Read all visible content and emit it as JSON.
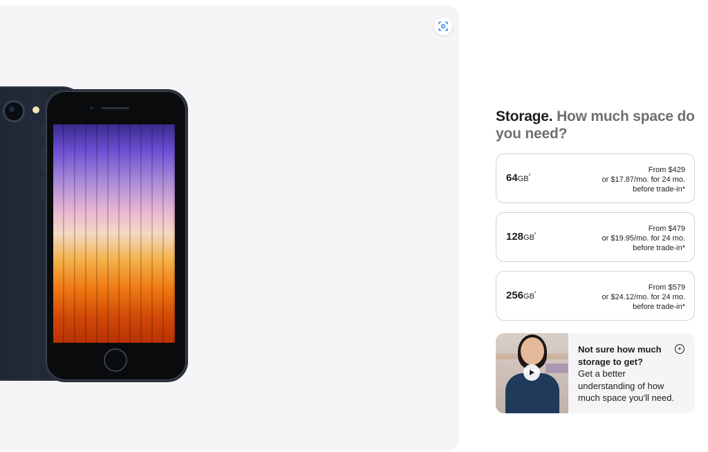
{
  "gallery": {
    "zoom_icon": "scan-zoom-icon",
    "background": "#f5f5f7"
  },
  "storage": {
    "heading_strong": "Storage.",
    "heading_muted": "How much space do you need?",
    "options": [
      {
        "size": "64",
        "unit": "GB",
        "footnote": "²",
        "from": "From $429",
        "monthly": "or $17.87/mo. for 24 mo.",
        "note": "before trade‑in*"
      },
      {
        "size": "128",
        "unit": "GB",
        "footnote": "²",
        "from": "From $479",
        "monthly": "or $19.95/mo. for 24 mo.",
        "note": "before trade‑in*"
      },
      {
        "size": "256",
        "unit": "GB",
        "footnote": "²",
        "from": "From $579",
        "monthly": "or $24.12/mo. for 24 mo.",
        "note": "before trade‑in*"
      }
    ],
    "help": {
      "question": "Not sure how much storage to get?",
      "answer": "Get a better understanding of how much space you'll need.",
      "play_icon": "play-icon",
      "expand_icon": "plus-circle-icon"
    }
  },
  "colors": {
    "text": "#1d1d1f",
    "muted": "#6e6e73",
    "border": "#d2d2d7"
  }
}
